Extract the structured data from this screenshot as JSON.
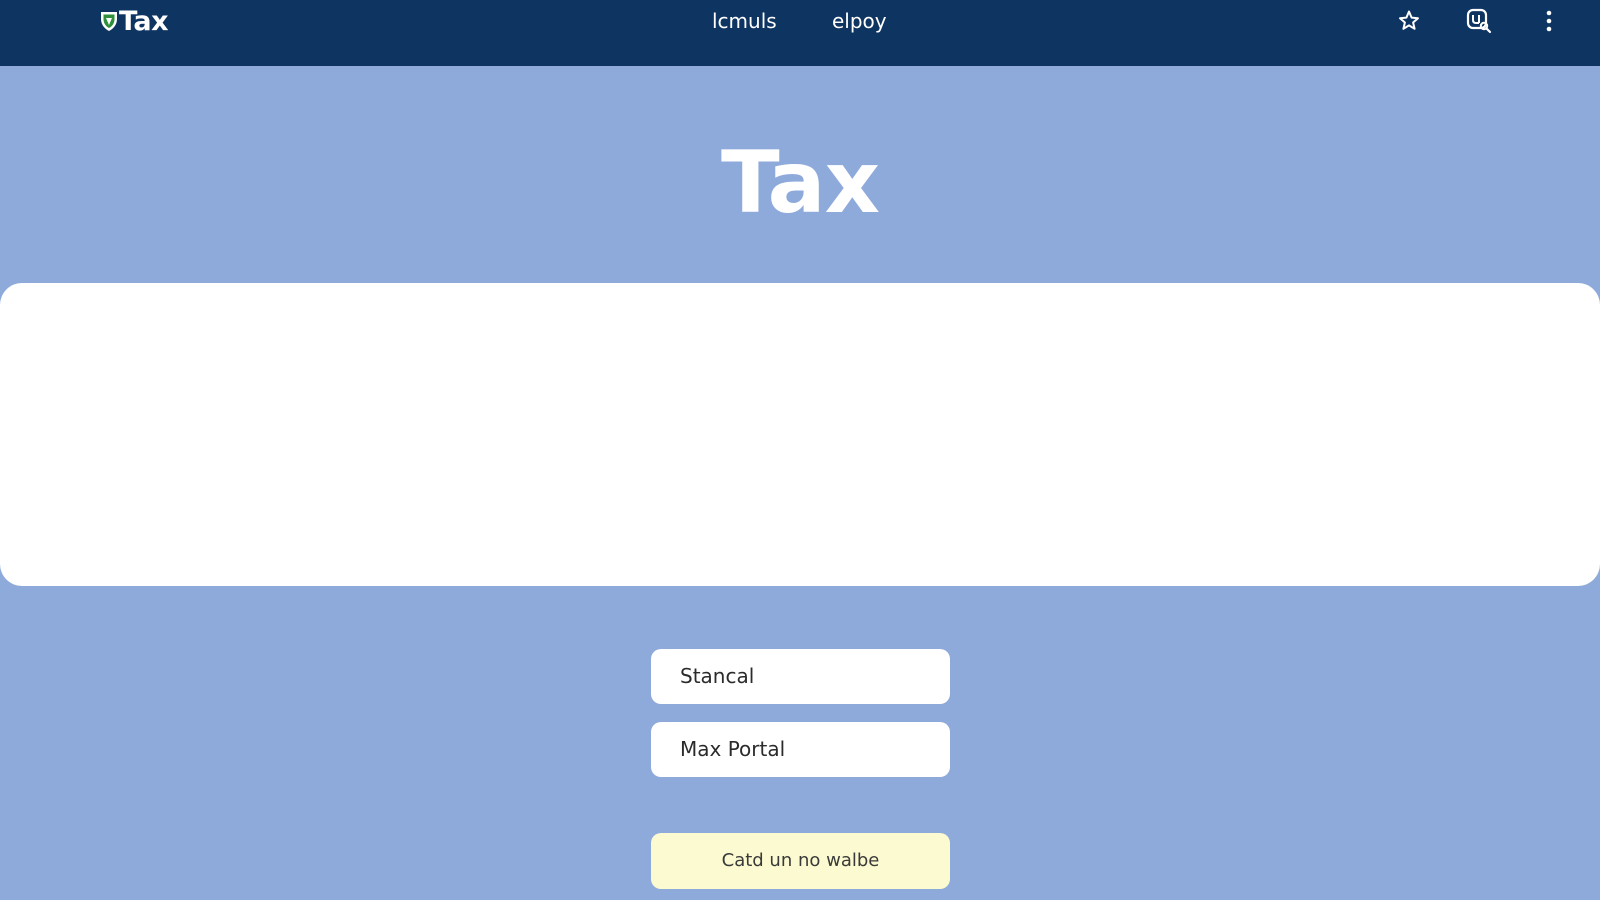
{
  "header": {
    "brand_name": "Tax",
    "brand_logo_icon": "shield-icon",
    "nav_links": [
      {
        "label": "lcmuls"
      },
      {
        "label": "elpoy"
      }
    ],
    "icons": [
      "star-icon",
      "search-icon",
      "more-vertical-icon"
    ]
  },
  "hero": {
    "title": "Tax"
  },
  "form": {
    "fields": [
      {
        "value": "Stancal"
      },
      {
        "value": "Max Portal"
      }
    ],
    "action_label": "Catd un no walbe"
  },
  "colors": {
    "header_background": "#0e3462",
    "page_background": "#8eaadb",
    "panel_background": "#ffffff",
    "button_background": "#fbfad0",
    "logo_green": "#2f8f3a"
  }
}
